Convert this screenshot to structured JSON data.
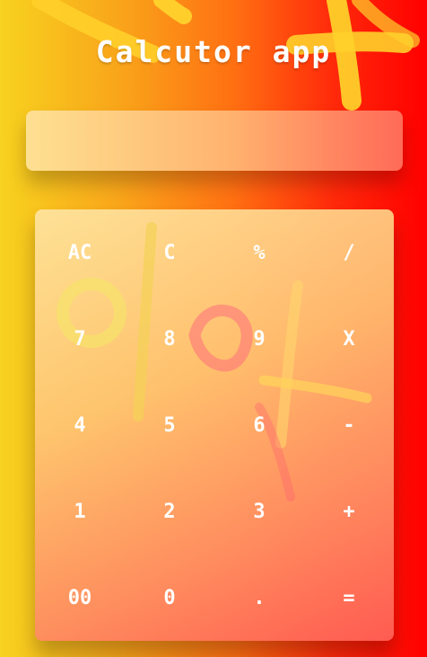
{
  "app": {
    "title": "Calcutor app"
  },
  "display": {
    "value": ""
  },
  "keypad": {
    "keys": [
      "AC",
      "C",
      "%",
      "/",
      "7",
      "8",
      "9",
      "X",
      "4",
      "5",
      "6",
      "-",
      "1",
      "2",
      "3",
      "+",
      "00",
      "0",
      ".",
      "="
    ]
  },
  "colors": {
    "background_left": "#f7d21f",
    "background_right": "#ff0000",
    "text": "#ffffff"
  }
}
